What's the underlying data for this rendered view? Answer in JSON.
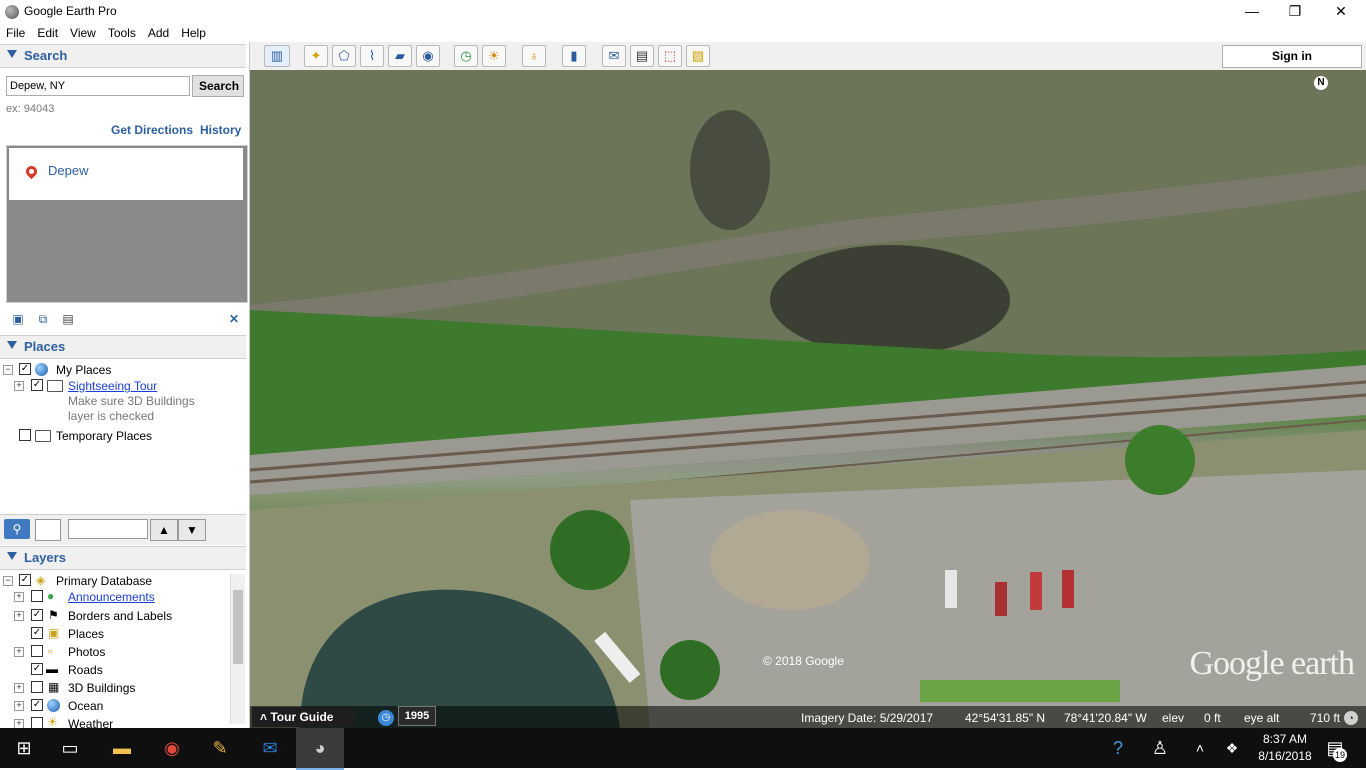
{
  "window": {
    "title": "Google Earth Pro",
    "minimize": "—",
    "maximize": "❐",
    "close": "✕"
  },
  "menu": [
    "File",
    "Edit",
    "View",
    "Tools",
    "Add",
    "Help"
  ],
  "search": {
    "header": "Search",
    "input_value": "Depew, NY",
    "button_label": "Search",
    "example_text": "ex: 94043",
    "get_directions": "Get Directions",
    "history": "History",
    "result_label": "Depew",
    "close_icon": "✕"
  },
  "places": {
    "header": "Places",
    "my_places": "My Places",
    "sightseeing_tour": "Sightseeing Tour",
    "note_line1": "Make sure 3D Buildings",
    "note_line2": "layer is checked",
    "temporary_places": "Temporary Places"
  },
  "layers": {
    "header": "Layers",
    "items": [
      {
        "label": "Primary Database",
        "checked": true
      },
      {
        "label": "Announcements",
        "checked": false
      },
      {
        "label": "Borders and Labels",
        "checked": true
      },
      {
        "label": "Places",
        "checked": true
      },
      {
        "label": "Photos",
        "checked": false
      },
      {
        "label": "Roads",
        "checked": true
      },
      {
        "label": "3D Buildings",
        "checked": false
      },
      {
        "label": "Ocean",
        "checked": true
      },
      {
        "label": "Weather",
        "checked": false
      }
    ]
  },
  "toolbar": {
    "sign_in": "Sign in"
  },
  "map": {
    "compass_label": "N",
    "copyright": "© 2018 Google",
    "watermark": "Google earth",
    "tour_guide": "Tour Guide",
    "history_year": "1995",
    "imagery_date": "Imagery Date: 5/29/2017",
    "latitude": "42°54'31.85\" N",
    "longitude": "78°41'20.84\" W",
    "elev_label": "elev",
    "elev_value": "0 ft",
    "eye_alt_label": "eye alt",
    "eye_alt_value": "710 ft"
  },
  "taskbar": {
    "time": "8:37 AM",
    "date": "8/16/2018",
    "notifications": "19"
  }
}
